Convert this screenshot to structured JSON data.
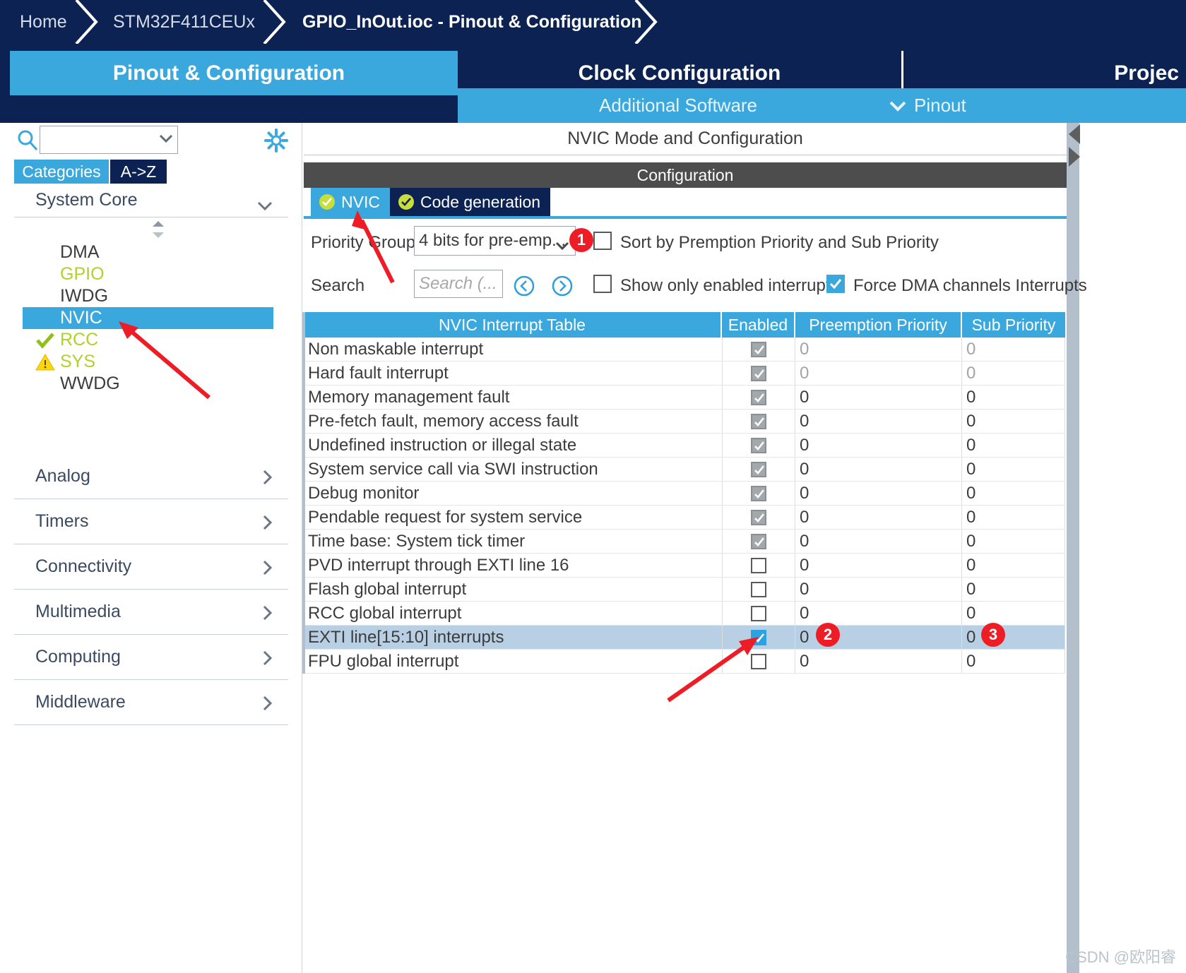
{
  "breadcrumb": {
    "items": [
      {
        "label": "Home",
        "active": false
      },
      {
        "label": "STM32F411CEUx",
        "active": false
      },
      {
        "label": "GPIO_InOut.ioc - Pinout & Configuration",
        "active": true
      }
    ]
  },
  "main_tabs": [
    {
      "label": "Pinout & Configuration",
      "selected": true
    },
    {
      "label": "Clock Configuration",
      "selected": false
    },
    {
      "label": "Projec",
      "selected": false
    }
  ],
  "sub_bar": {
    "additional_software": "Additional Software",
    "pinout": "Pinout",
    "pinout_caret": "chevron-down-icon"
  },
  "sidebar": {
    "search_value": "",
    "search_icon": "search-icon",
    "gear_icon": "gear-icon",
    "view_tabs": [
      {
        "label": "Categories",
        "selected": true
      },
      {
        "label": "A->Z",
        "selected": false
      }
    ],
    "system_core": {
      "label": "System Core",
      "expanded": true,
      "items": [
        {
          "label": "DMA",
          "state": "normal",
          "marker": "none"
        },
        {
          "label": "GPIO",
          "state": "lime",
          "marker": "none"
        },
        {
          "label": "IWDG",
          "state": "normal",
          "marker": "none"
        },
        {
          "label": "NVIC",
          "state": "selected",
          "marker": "none"
        },
        {
          "label": "RCC",
          "state": "lime",
          "marker": "check-icon"
        },
        {
          "label": "SYS",
          "state": "lime",
          "marker": "warning-icon"
        },
        {
          "label": "WWDG",
          "state": "normal",
          "marker": "none"
        }
      ]
    },
    "categories": [
      {
        "label": "Analog"
      },
      {
        "label": "Timers"
      },
      {
        "label": "Connectivity"
      },
      {
        "label": "Multimedia"
      },
      {
        "label": "Computing"
      },
      {
        "label": "Middleware"
      }
    ]
  },
  "panel": {
    "mode_header": "NVIC Mode and Configuration",
    "configuration_band": "Configuration",
    "inner_tabs": [
      {
        "label": "NVIC",
        "selected": true,
        "status_icon": "check-circle-icon"
      },
      {
        "label": "Code generation",
        "selected": false,
        "status_icon": "check-circle-icon"
      }
    ],
    "priority_group_label": "Priority Group",
    "priority_group_value": "4 bits for pre-emp...",
    "sort_by_label": "Sort by Premption Priority and Sub Priority",
    "sort_by_checked": false,
    "search_label": "Search",
    "search_placeholder": "Search (...",
    "search_value": "",
    "prev_icon": "chevron-left-circle-icon",
    "next_icon": "chevron-right-circle-icon",
    "show_only_enabled_label": "Show only enabled interrupts",
    "show_only_enabled_checked": false,
    "force_dma_label": "Force DMA channels Interrupts",
    "force_dma_checked": true
  },
  "table": {
    "columns": [
      "NVIC Interrupt Table",
      "Enabled",
      "Preemption Priority",
      "Sub Priority"
    ],
    "rows": [
      {
        "name": "Non maskable interrupt",
        "enabled": true,
        "readonly": true,
        "preemption": "0",
        "sub": "0",
        "dim": true,
        "highlight": false
      },
      {
        "name": "Hard fault interrupt",
        "enabled": true,
        "readonly": true,
        "preemption": "0",
        "sub": "0",
        "dim": true,
        "highlight": false
      },
      {
        "name": "Memory management fault",
        "enabled": true,
        "readonly": true,
        "preemption": "0",
        "sub": "0",
        "dim": false,
        "highlight": false
      },
      {
        "name": "Pre-fetch fault, memory access fault",
        "enabled": true,
        "readonly": true,
        "preemption": "0",
        "sub": "0",
        "dim": false,
        "highlight": false
      },
      {
        "name": "Undefined instruction or illegal state",
        "enabled": true,
        "readonly": true,
        "preemption": "0",
        "sub": "0",
        "dim": false,
        "highlight": false
      },
      {
        "name": "System service call via SWI instruction",
        "enabled": true,
        "readonly": true,
        "preemption": "0",
        "sub": "0",
        "dim": false,
        "highlight": false
      },
      {
        "name": "Debug monitor",
        "enabled": true,
        "readonly": true,
        "preemption": "0",
        "sub": "0",
        "dim": false,
        "highlight": false
      },
      {
        "name": "Pendable request for system service",
        "enabled": true,
        "readonly": true,
        "preemption": "0",
        "sub": "0",
        "dim": false,
        "highlight": false
      },
      {
        "name": "Time base: System tick timer",
        "enabled": true,
        "readonly": true,
        "preemption": "0",
        "sub": "0",
        "dim": false,
        "highlight": false
      },
      {
        "name": "PVD interrupt through EXTI line 16",
        "enabled": false,
        "readonly": false,
        "preemption": "0",
        "sub": "0",
        "dim": false,
        "highlight": false
      },
      {
        "name": "Flash global interrupt",
        "enabled": false,
        "readonly": false,
        "preemption": "0",
        "sub": "0",
        "dim": false,
        "highlight": false
      },
      {
        "name": "RCC global interrupt",
        "enabled": false,
        "readonly": false,
        "preemption": "0",
        "sub": "0",
        "dim": false,
        "highlight": false
      },
      {
        "name": "EXTI line[15:10] interrupts",
        "enabled": true,
        "readonly": false,
        "preemption": "0",
        "sub": "0",
        "dim": false,
        "highlight": true
      },
      {
        "name": "FPU global interrupt",
        "enabled": false,
        "readonly": false,
        "preemption": "0",
        "sub": "0",
        "dim": false,
        "highlight": false
      }
    ]
  },
  "annotations": {
    "badges": [
      {
        "label": "1"
      },
      {
        "label": "2"
      },
      {
        "label": "3"
      }
    ],
    "accent_color": "#ee1c25"
  },
  "watermark": "CSDN @欧阳睿",
  "colors": {
    "brand_dark": "#0b2253",
    "brand_blue": "#3aa8dc",
    "lime": "#b0d12a",
    "highlight_row": "#b8cfe4"
  }
}
